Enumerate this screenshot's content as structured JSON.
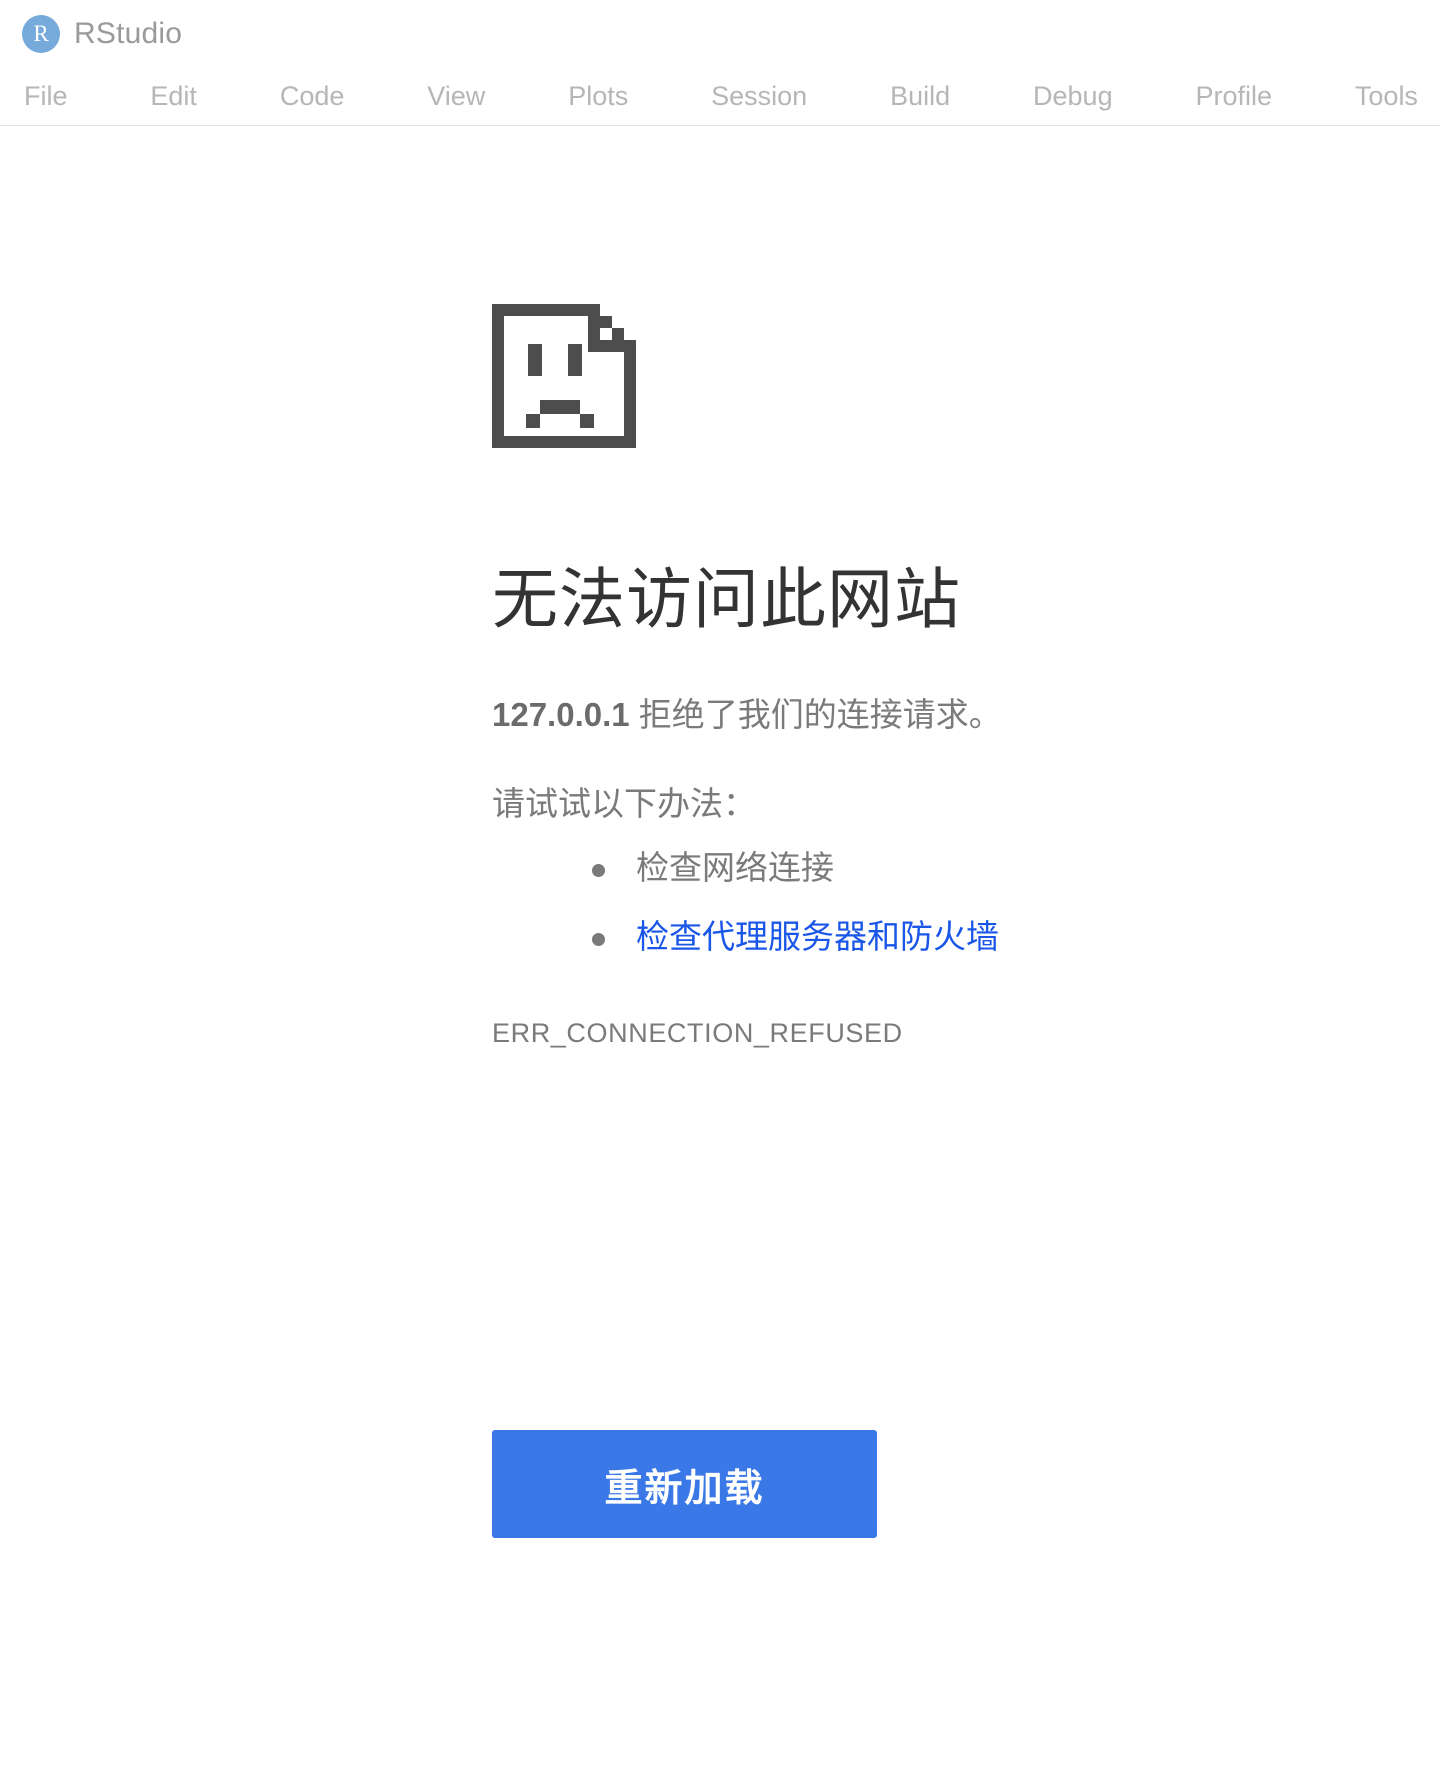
{
  "window": {
    "app_name": "RStudio",
    "logo_glyph": "R",
    "menu": [
      {
        "label": "File"
      },
      {
        "label": "Edit"
      },
      {
        "label": "Code"
      },
      {
        "label": "View"
      },
      {
        "label": "Plots"
      },
      {
        "label": "Session"
      },
      {
        "label": "Build"
      },
      {
        "label": "Debug"
      },
      {
        "label": "Profile"
      },
      {
        "label": "Tools"
      }
    ]
  },
  "error_page": {
    "icon": "sad-page-icon",
    "heading": "无法访问此网站",
    "host": "127.0.0.1",
    "summary_rest": " 拒绝了我们的连接请求。",
    "suggestions_title": "请试试以下办法：",
    "suggestions": [
      {
        "label": "检查网络连接",
        "is_link": false
      },
      {
        "label": "检查代理服务器和防火墙",
        "is_link": true
      }
    ],
    "error_code": "ERR_CONNECTION_REFUSED",
    "reload_button": "重新加载"
  },
  "colors": {
    "link": "#1a56e8",
    "button": "#3b78e7",
    "rstudio_blue": "#75AADB",
    "text_muted": "#7a7a7a",
    "heading": "#333333"
  }
}
